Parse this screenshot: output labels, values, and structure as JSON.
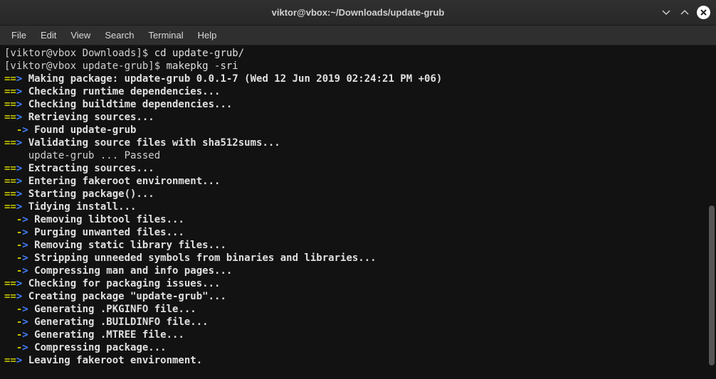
{
  "titlebar": {
    "title": "viktor@vbox:~/Downloads/update-grub"
  },
  "menu": [
    "File",
    "Edit",
    "View",
    "Search",
    "Terminal",
    "Help"
  ],
  "lines": [
    {
      "type": "prompt",
      "user": "[viktor@vbox Downloads]$",
      "cmd": " cd update-grub/"
    },
    {
      "type": "prompt",
      "user": "[viktor@vbox update-grub]$",
      "cmd": " makepkg -sri"
    },
    {
      "type": "main",
      "msg": "Making package: update-grub 0.0.1-7 (Wed 12 Jun 2019 02:24:21 PM +06)"
    },
    {
      "type": "main",
      "msg": "Checking runtime dependencies..."
    },
    {
      "type": "main",
      "msg": "Checking buildtime dependencies..."
    },
    {
      "type": "main",
      "msg": "Retrieving sources..."
    },
    {
      "type": "sub",
      "msg": "Found update-grub"
    },
    {
      "type": "main",
      "msg": "Validating source files with sha512sums..."
    },
    {
      "type": "plain",
      "msg": "    update-grub ... Passed"
    },
    {
      "type": "main",
      "msg": "Extracting sources..."
    },
    {
      "type": "main",
      "msg": "Entering fakeroot environment..."
    },
    {
      "type": "main",
      "msg": "Starting package()..."
    },
    {
      "type": "main",
      "msg": "Tidying install..."
    },
    {
      "type": "sub",
      "msg": "Removing libtool files..."
    },
    {
      "type": "sub",
      "msg": "Purging unwanted files..."
    },
    {
      "type": "sub",
      "msg": "Removing static library files..."
    },
    {
      "type": "sub",
      "msg": "Stripping unneeded symbols from binaries and libraries..."
    },
    {
      "type": "sub",
      "msg": "Compressing man and info pages..."
    },
    {
      "type": "main",
      "msg": "Checking for packaging issues..."
    },
    {
      "type": "main",
      "msg": "Creating package \"update-grub\"..."
    },
    {
      "type": "sub",
      "msg": "Generating .PKGINFO file..."
    },
    {
      "type": "sub",
      "msg": "Generating .BUILDINFO file..."
    },
    {
      "type": "sub",
      "msg": "Generating .MTREE file..."
    },
    {
      "type": "sub",
      "msg": "Compressing package..."
    },
    {
      "type": "main",
      "msg": "Leaving fakeroot environment."
    }
  ]
}
